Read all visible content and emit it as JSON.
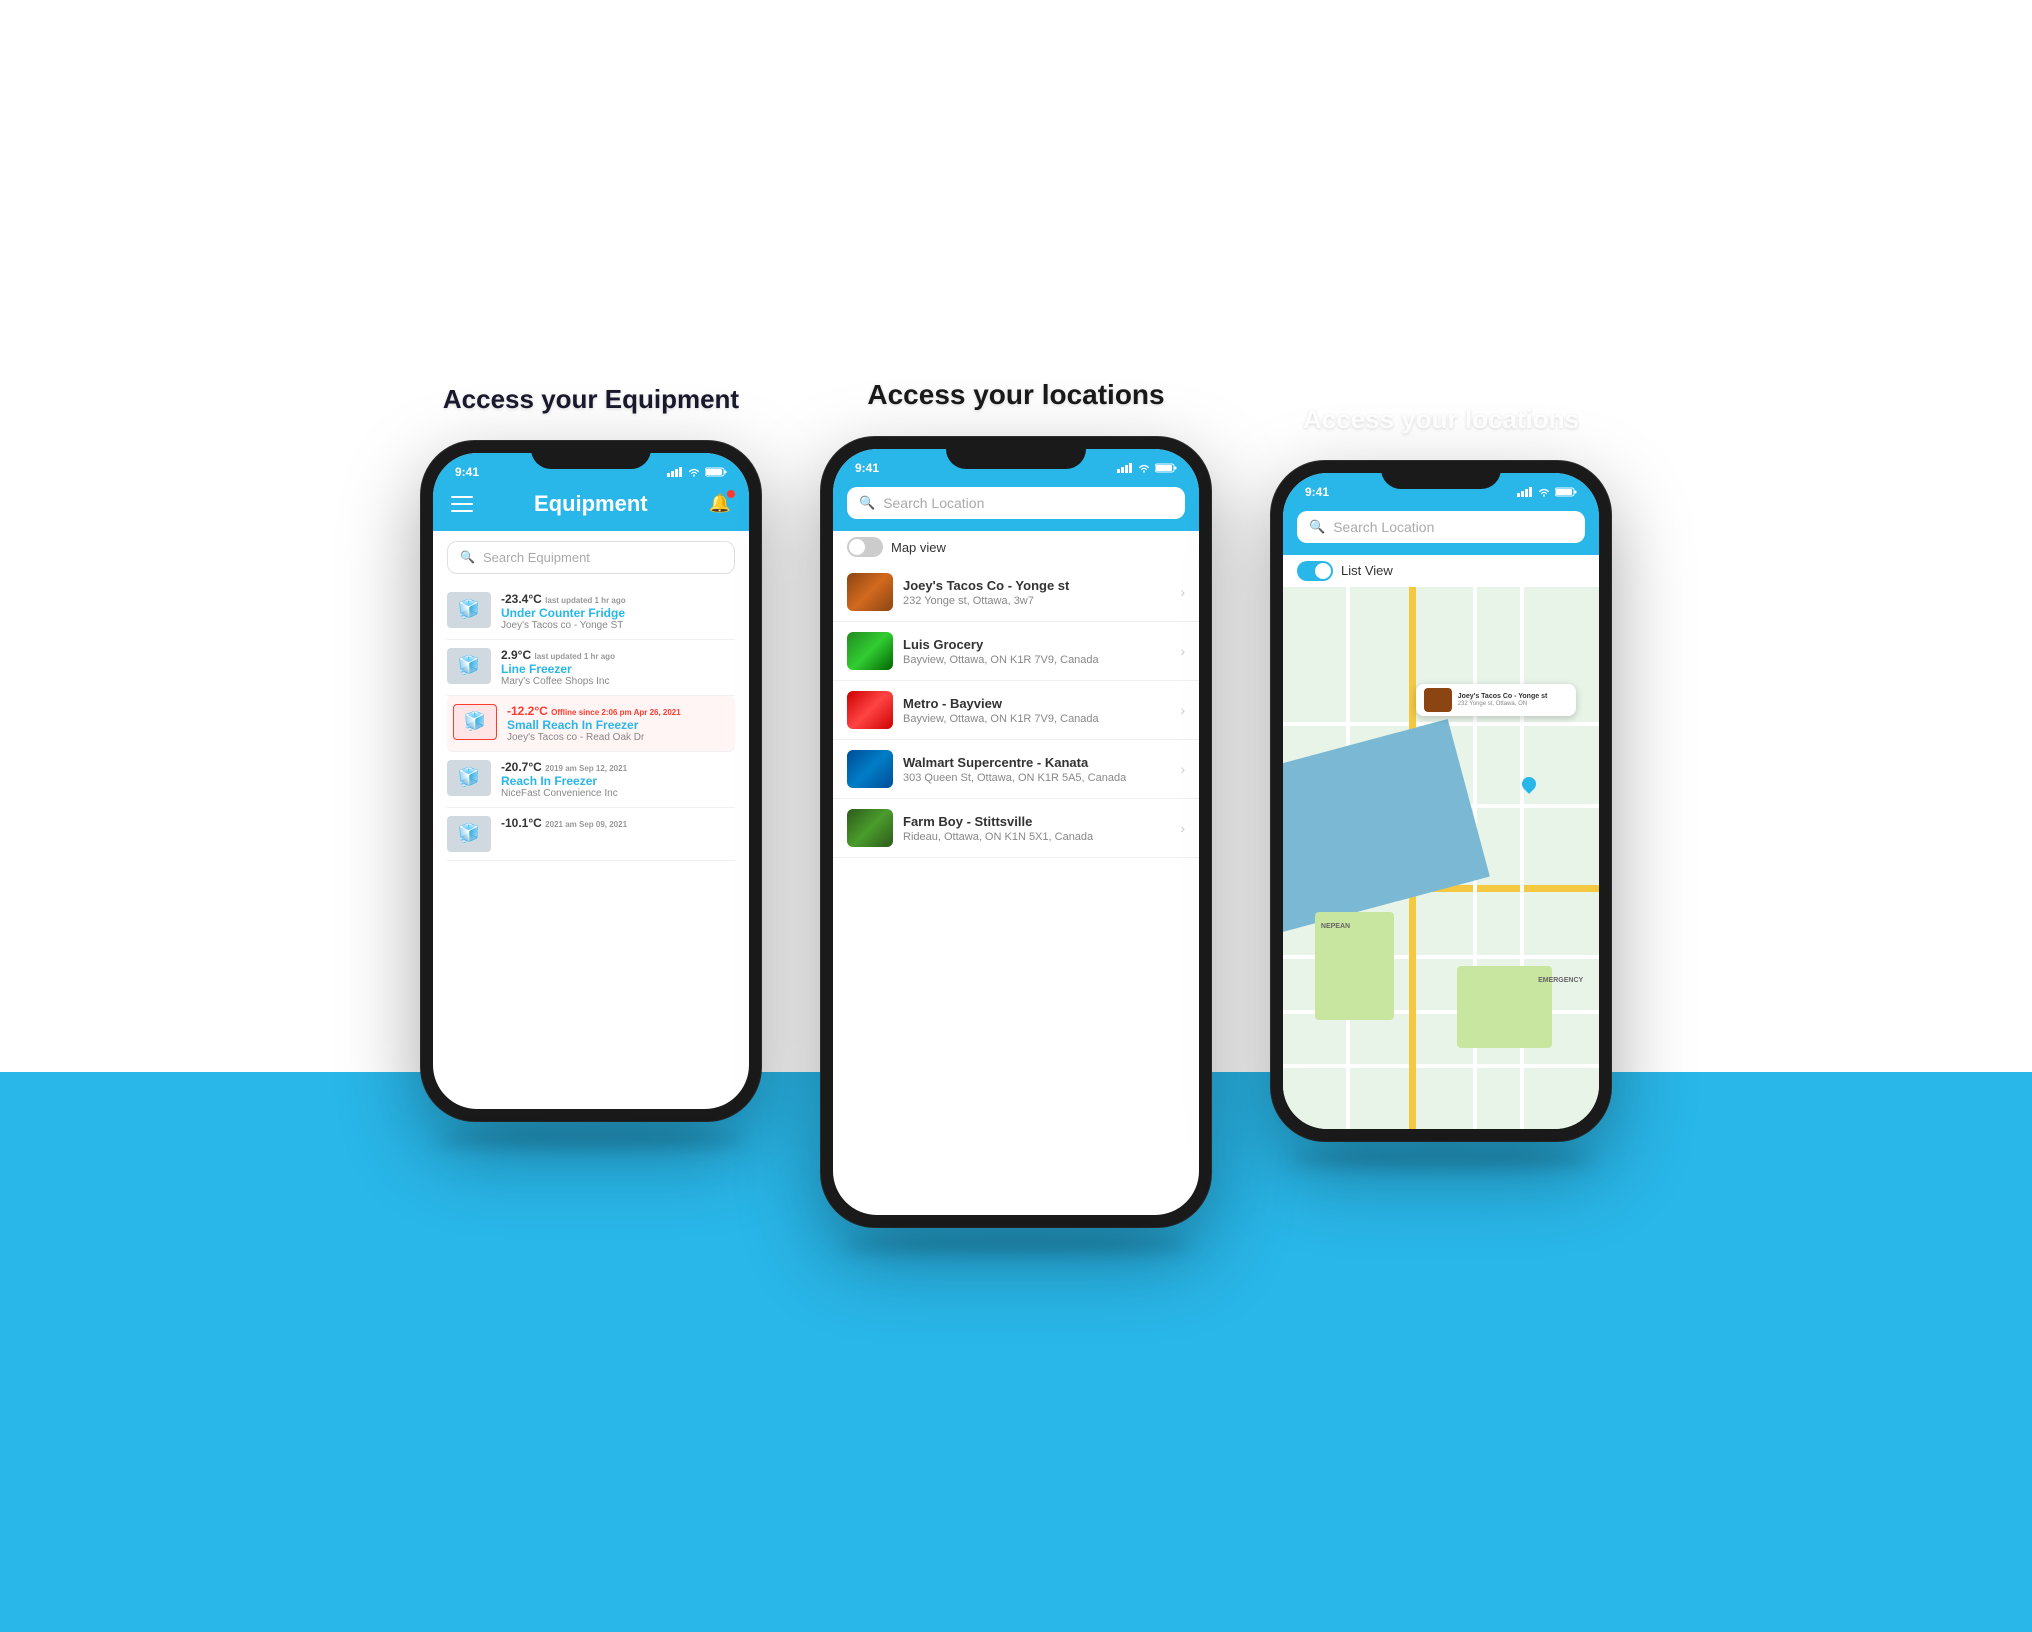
{
  "background": {
    "top_color": "#ffffff",
    "bottom_color": "#29b6e8"
  },
  "phones": [
    {
      "id": "phone-equipment",
      "label": "Access your Equipment",
      "position": "left",
      "screen": {
        "status_time": "9:41",
        "header_title": "Equipment",
        "search_placeholder": "Search Equipment",
        "equipment_items": [
          {
            "temp": "-23.4°C",
            "temp_note": "last updated 1 hr ago",
            "name": "Under Counter Fridge",
            "location": "Joey's Tacos co - Yonge ST",
            "alert": false
          },
          {
            "temp": "2.9°C",
            "temp_note": "last updated 1 hr ago",
            "name": "Line Freezer",
            "location": "Mary's Coffee Shops Inc",
            "alert": false
          },
          {
            "temp": "-12.2°C",
            "temp_note": "Offline since 2:06 pm Apr 26, 2021",
            "name": "Small Reach In Freezer",
            "location": "Joey's Tacos co - Read Oak Dr",
            "alert": true
          },
          {
            "temp": "-20.7°C",
            "temp_note": "2019 am Sep 12, 2021",
            "name": "Reach In Freezer",
            "location": "NiceFast Convenience Inc",
            "alert": false
          },
          {
            "temp": "-10.1°C",
            "temp_note": "2021 am Sep 09, 2021",
            "name": "",
            "location": "",
            "alert": false
          }
        ]
      }
    },
    {
      "id": "phone-locations-list",
      "label": "Access your locations",
      "position": "center",
      "screen": {
        "status_time": "9:41",
        "search_placeholder": "Search Location",
        "toggle_label": "Map view",
        "toggle_on": false,
        "location_items": [
          {
            "name": "Joey's Tacos Co - Yonge st",
            "address": "232 Yonge st, Ottawa, 3w7",
            "thumb_class": "loc-thumb-tacos"
          },
          {
            "name": "Luis Grocery",
            "address": "Bayview, Ottawa, ON K1R 7V9, Canada",
            "thumb_class": "loc-thumb-grocery"
          },
          {
            "name": "Metro - Bayview",
            "address": "Bayview, Ottawa, ON K1R 7V9, Canada",
            "thumb_class": "loc-thumb-metro"
          },
          {
            "name": "Walmart Supercentre - Kanata",
            "address": "303 Queen St, Ottawa, ON K1R 5A5, Canada",
            "thumb_class": "loc-thumb-walmart"
          },
          {
            "name": "Farm Boy - Stittsville",
            "address": "Rideau, Ottawa, ON K1N 5X1, Canada",
            "thumb_class": "loc-thumb-farmboy"
          }
        ]
      }
    },
    {
      "id": "phone-locations-map",
      "label": "Access your locations",
      "position": "right",
      "screen": {
        "status_time": "9:41",
        "search_placeholder": "Search Location",
        "toggle_label": "List View",
        "toggle_on": true,
        "map_popup": {
          "name": "Joey's Tacos Co - Yonge st",
          "address": "232 Yonge st, Ottawa, ON"
        }
      }
    }
  ]
}
